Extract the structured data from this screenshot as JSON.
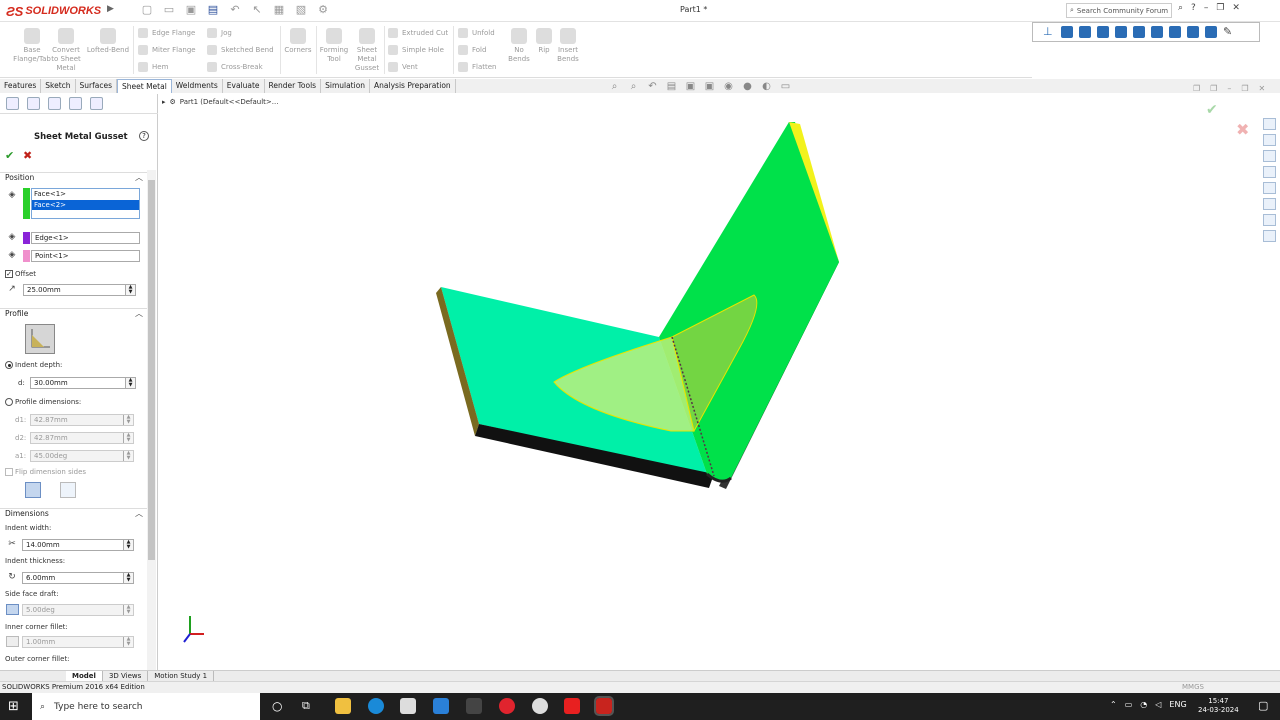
{
  "app": {
    "logo": "SOLIDWORKS",
    "doc_title": "Part1 *",
    "search_placeholder": "Search Community Forum"
  },
  "command_manager": {
    "left": [
      {
        "label": "Base Flange/Tab"
      },
      {
        "label": "Convert to Sheet Metal"
      },
      {
        "label": "Lofted-Bend"
      }
    ],
    "col1": [
      "Edge Flange",
      "Miter Flange",
      "Hem"
    ],
    "col2": [
      "Jog",
      "Sketched Bend",
      "Cross-Break"
    ],
    "mid": [
      {
        "label": "Corners"
      },
      {
        "label": "Forming Tool"
      },
      {
        "label": "Sheet Metal Gusset"
      }
    ],
    "col3": [
      "Extruded Cut",
      "Simple Hole",
      "Vent"
    ],
    "col4": [
      "Unfold",
      "Fold",
      "Flatten"
    ],
    "right": [
      {
        "label": "No Bends"
      },
      {
        "label": "Rip"
      },
      {
        "label": "Insert Bends"
      }
    ]
  },
  "tabs": [
    "Features",
    "Sketch",
    "Surfaces",
    "Sheet Metal",
    "Weldments",
    "Evaluate",
    "Render Tools",
    "Simulation",
    "Analysis Preparation"
  ],
  "property_manager": {
    "title": "Sheet Metal Gusset",
    "help": "?",
    "position": {
      "header": "Position",
      "faces": [
        "Face<1>",
        "Face<2>"
      ],
      "edge": "Edge<1>",
      "point": "Point<1>",
      "offset_label": "Offset",
      "offset_value": "25.00mm"
    },
    "profile": {
      "header": "Profile",
      "indent_depth_label": "Indent depth:",
      "d_label": "d:",
      "d_value": "30.00mm",
      "profile_dims_label": "Profile dimensions:",
      "d1_label": "d1:",
      "d1_value": "42.87mm",
      "d2_label": "d2:",
      "d2_value": "42.87mm",
      "a1_label": "a1:",
      "a1_value": "45.00deg",
      "flip_label": "Flip dimension sides"
    },
    "dimensions": {
      "header": "Dimensions",
      "indent_width_label": "Indent width:",
      "indent_width_value": "14.00mm",
      "indent_thickness_label": "Indent thickness:",
      "indent_thickness_value": "6.00mm",
      "side_draft_label": "Side face draft:",
      "side_draft_value": "5.00deg",
      "inner_fillet_label": "Inner corner fillet:",
      "inner_fillet_value": "1.00mm",
      "outer_fillet_label": "Outer corner fillet:"
    }
  },
  "tree": {
    "item": "Part1  (Default<<Default>..."
  },
  "bottom_tabs": [
    "Model",
    "3D Views",
    "Motion Study 1"
  ],
  "status": {
    "text": "SOLIDWORKS Premium 2016 x64 Edition",
    "units": "MMGS"
  },
  "taskbar": {
    "search_placeholder": "Type here to search",
    "lang": "ENG",
    "time": "15:47",
    "date": "24-03-2024"
  },
  "colors": {
    "face_green": "#00ee55",
    "face_cyan": "#00f0a8",
    "edge_yellow": "#f2f21c",
    "gusset": "#c8f07a"
  }
}
